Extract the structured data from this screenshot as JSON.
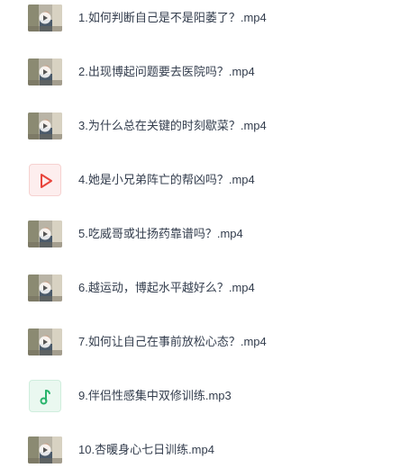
{
  "files": [
    {
      "name": "1.如何判断自己是不是阳萎了？.mp4",
      "kind": "video",
      "icon": "video-thumbnail"
    },
    {
      "name": "2.出现博起问题要去医院吗？.mp4",
      "kind": "video",
      "icon": "video-thumbnail"
    },
    {
      "name": "3.为什么总在关键的时刻歇菜？.mp4",
      "kind": "video",
      "icon": "video-thumbnail"
    },
    {
      "name": "4.她是小兄弟阵亡的帮凶吗？.mp4",
      "kind": "video-generic",
      "icon": "video-play-icon"
    },
    {
      "name": "5.吃威哥或壮扬药靠谱吗？.mp4",
      "kind": "video",
      "icon": "video-thumbnail"
    },
    {
      "name": "6.越运动，博起水平越好么？.mp4",
      "kind": "video",
      "icon": "video-thumbnail"
    },
    {
      "name": "7.如何让自己在事前放松心态？.mp4",
      "kind": "video",
      "icon": "video-thumbnail"
    },
    {
      "name": "9.伴侣性感集中双修训练.mp3",
      "kind": "audio",
      "icon": "music-note-icon"
    },
    {
      "name": "10.杏暖身心七日训练.mp4",
      "kind": "video",
      "icon": "video-thumbnail"
    }
  ],
  "colors": {
    "text": "#333d4d",
    "video_icon_bg": "#fdeeee",
    "video_icon_accent": "#e8453c",
    "audio_icon_bg": "#e8f7ef",
    "audio_icon_accent": "#27b46b"
  }
}
